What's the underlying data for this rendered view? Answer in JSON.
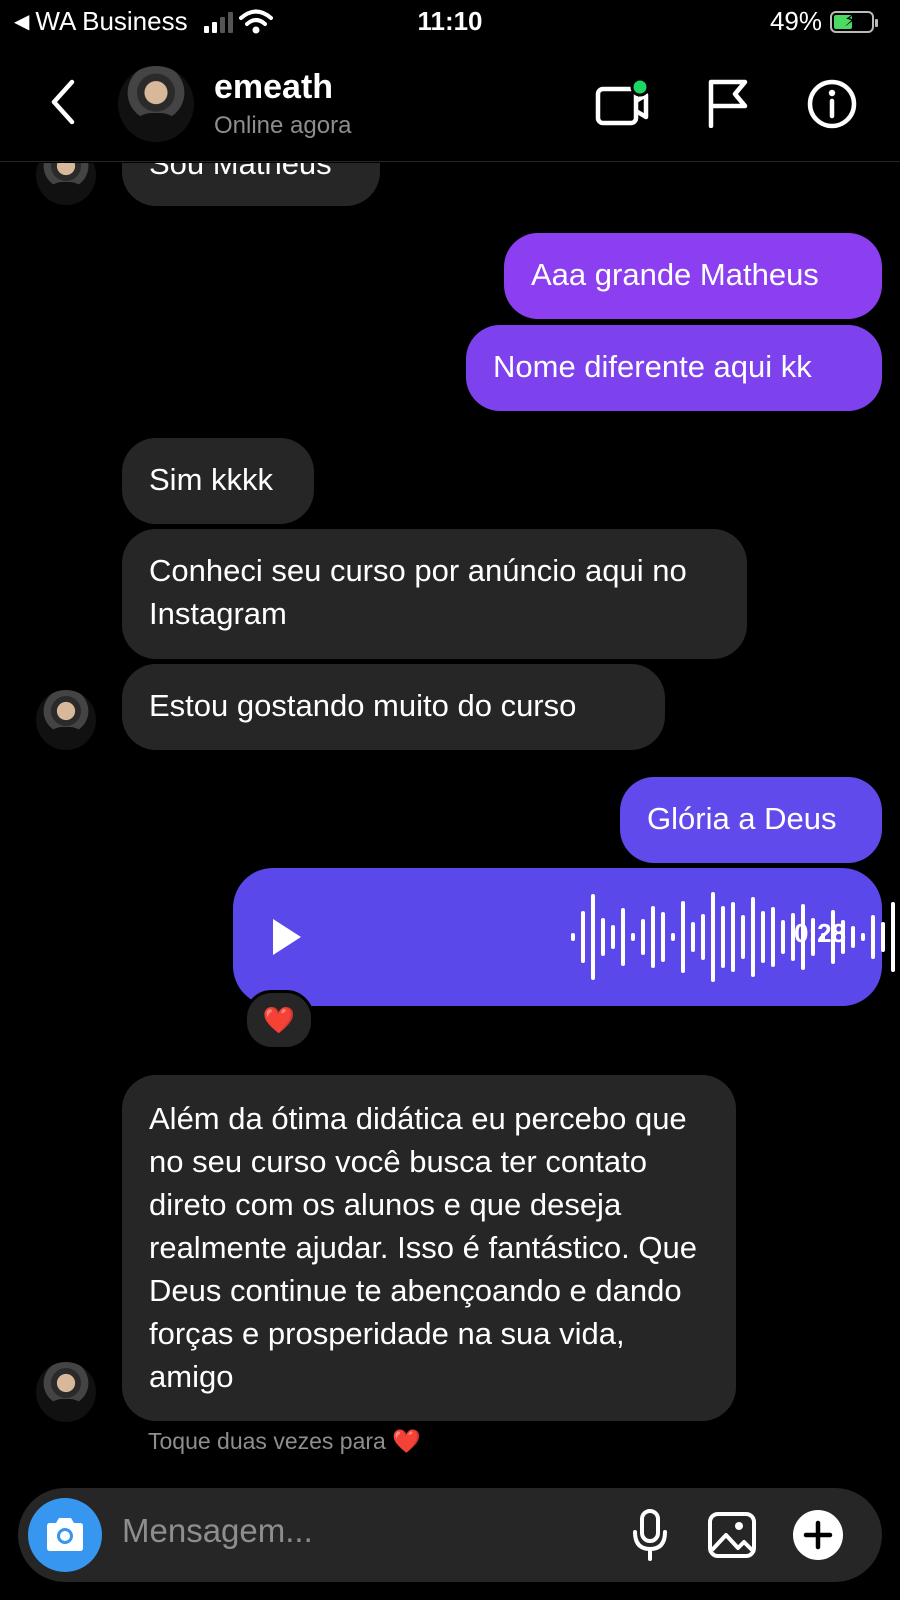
{
  "status_bar": {
    "back_app": "WA Business",
    "time": "11:10",
    "battery": "49%"
  },
  "header": {
    "username": "emeath",
    "status": "Online agora",
    "icons": [
      "back-chevron-icon",
      "video-call-icon",
      "flag-icon",
      "info-icon"
    ]
  },
  "messages": [
    {
      "id": "m0",
      "from": "them",
      "text": "Sou Matheus"
    },
    {
      "id": "m1",
      "from": "me",
      "text": "Aaa grande Matheus"
    },
    {
      "id": "m2",
      "from": "me",
      "text": "Nome diferente aqui kk"
    },
    {
      "id": "m3",
      "from": "them",
      "text": "Sim kkkk"
    },
    {
      "id": "m4",
      "from": "them",
      "text": "Conheci seu curso por anúncio aqui no Instagram"
    },
    {
      "id": "m5",
      "from": "them",
      "text": "Estou gostando muito do curso"
    },
    {
      "id": "m6",
      "from": "me",
      "text": "Glória a Deus"
    },
    {
      "id": "m7",
      "from": "me",
      "type": "voice",
      "duration": "0:28",
      "reaction": "❤️"
    },
    {
      "id": "m8",
      "from": "them",
      "text": "Além da ótima didática eu percebo que no seu curso você busca ter contato direto com os alunos e que deseja realmente ajudar. Isso é fantástico. Que Deus continue te abençoando e dando forças e prosperidade na sua vida, amigo"
    }
  ],
  "hint": "Toque duas vezes para ❤️",
  "composer": {
    "placeholder": "Mensagem...",
    "icons": [
      "camera-icon",
      "microphone-icon",
      "gallery-icon",
      "add-icon"
    ]
  },
  "colors": {
    "background": "#000000",
    "incoming_bubble": "#262626",
    "outgoing_top": "#8f3ff0",
    "outgoing_bottom": "#5a48ea",
    "camera_button": "#3797f0",
    "online_dot": "#1ed760"
  }
}
